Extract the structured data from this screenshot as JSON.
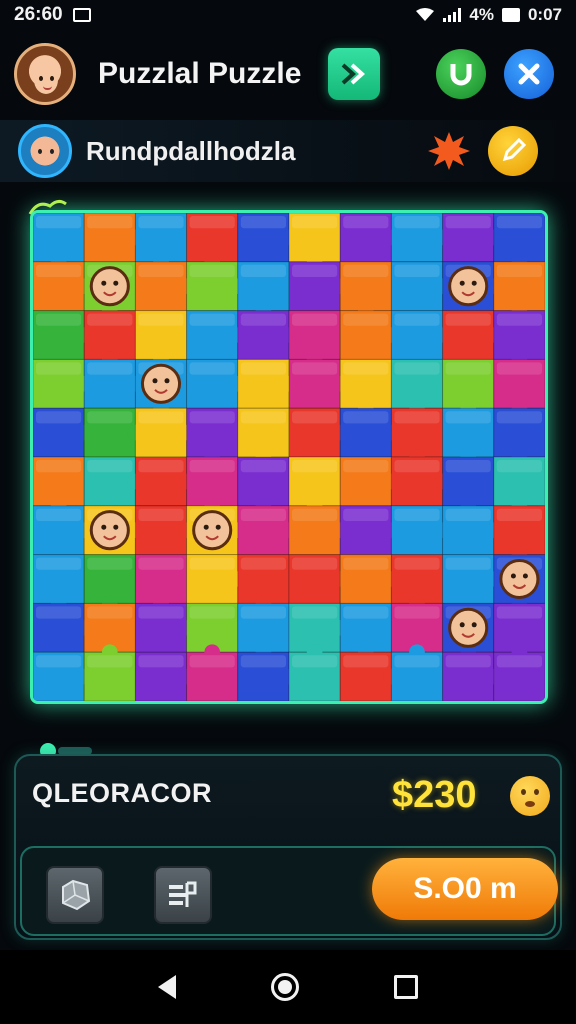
{
  "status_bar": {
    "time": "26:60",
    "battery_text": "4%",
    "extra": "0:07"
  },
  "header": {
    "title": "Puzzlal Puzzle",
    "play_icon": "double-chevron-right-icon",
    "green_icon": "horseshoe-icon",
    "blue_icon": "close-x-icon"
  },
  "subheader": {
    "title": "Rundpdallhodzla",
    "splat_icon": "splat-icon",
    "pencil_icon": "pencil-icon"
  },
  "board": {
    "rows": 10,
    "cols": 10,
    "palette": [
      "#e9372c",
      "#f47a1a",
      "#f6c51b",
      "#35b33a",
      "#1d9be0",
      "#2a4fd6",
      "#7b2ed0",
      "#d62d8a",
      "#2bc0b0",
      "#7ccf2f"
    ],
    "border_color": "#3cf0b0"
  },
  "panel": {
    "player_name": "QLEORACOR",
    "score": "$230",
    "action_label": "S.O0 m",
    "tool_icons": [
      "stone-block-icon",
      "filter-bars-icon"
    ]
  },
  "nav": {
    "back": "back-triangle-icon",
    "home": "home-circle-icon",
    "recent": "recent-square-icon"
  }
}
